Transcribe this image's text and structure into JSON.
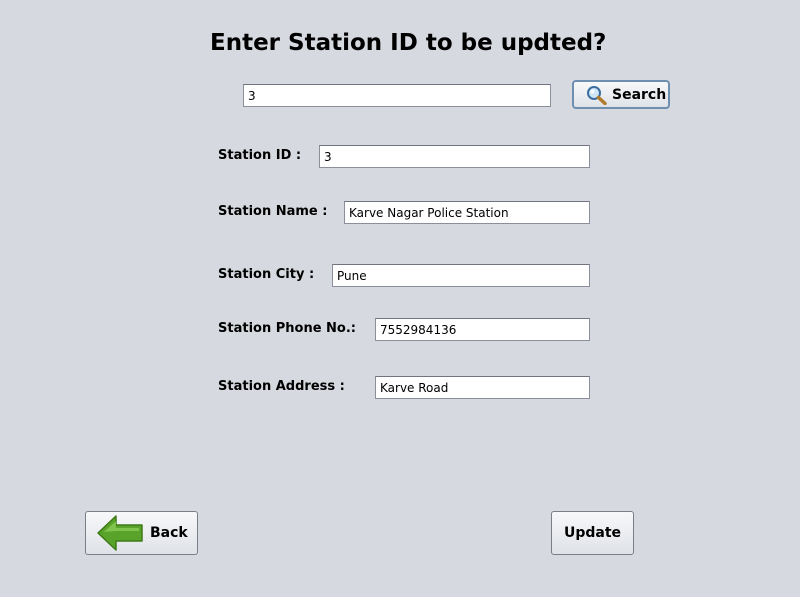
{
  "header": {
    "title": "Enter Station ID to be updted?"
  },
  "search": {
    "value": "3",
    "button_label": "Search",
    "icon": "magnifier-icon"
  },
  "form": {
    "station_id": {
      "label": "Station ID :",
      "value": "3"
    },
    "station_name": {
      "label": "Station Name :",
      "value": "Karve Nagar Police Station"
    },
    "station_city": {
      "label": "Station City :",
      "value": "Pune"
    },
    "station_phone": {
      "label": "Station Phone No.:",
      "value": "7552984136"
    },
    "station_address": {
      "label": "Station Address :",
      "value": "Karve Road"
    }
  },
  "actions": {
    "back_label": "Back",
    "back_icon": "back-arrow-icon",
    "update_label": "Update"
  },
  "colors": {
    "background": "#d6d9df",
    "arrow_green": "#5aa32a",
    "search_border": "#6e8fb0"
  }
}
